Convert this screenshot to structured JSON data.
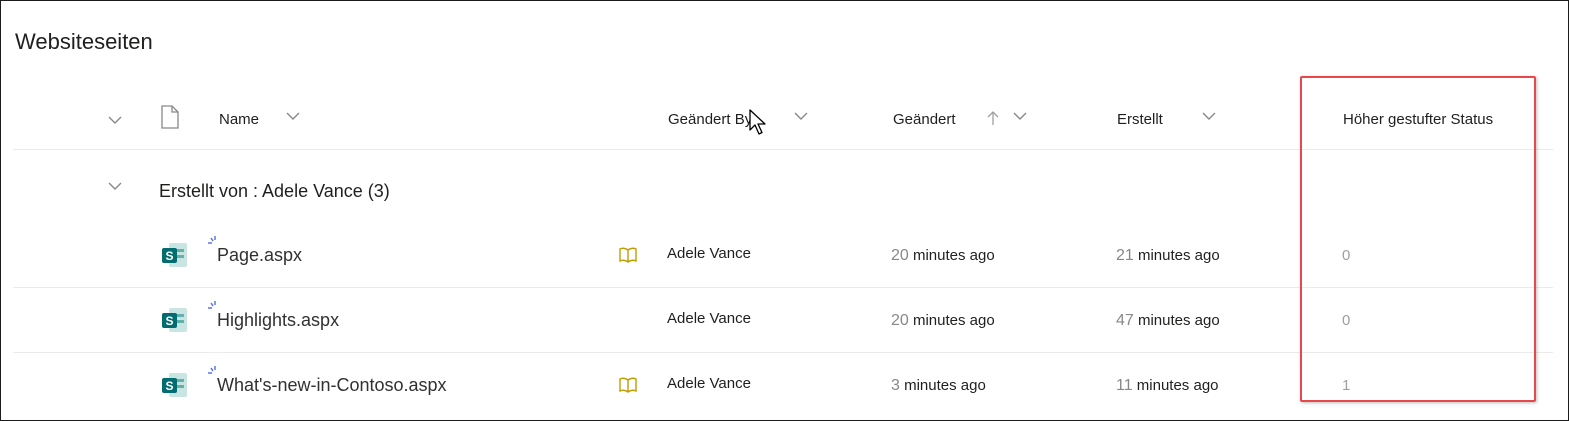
{
  "page": {
    "title": "Websiteseiten"
  },
  "header": {
    "name_label": "Name",
    "modified_by_label": "Geändert By",
    "modified_label": "Geändert",
    "created_label": "Erstellt",
    "promoted_state_label": "Höher gestufter Status"
  },
  "group": {
    "label": "Erstellt von : Adele Vance (3)"
  },
  "rows": [
    {
      "name": "Page.aspx",
      "has_book_icon": true,
      "modified_by": "Adele Vance",
      "modified_num": "20",
      "modified_unit": "minutes ago",
      "created_num": "21",
      "created_unit": "minutes ago",
      "promoted_state": "0"
    },
    {
      "name": "Highlights.aspx",
      "has_book_icon": false,
      "modified_by": "Adele Vance",
      "modified_num": "20",
      "modified_unit": "minutes ago",
      "created_num": "47",
      "created_unit": "minutes ago",
      "promoted_state": "0"
    },
    {
      "name": "What's-new-in-Contoso.aspx",
      "has_book_icon": true,
      "modified_by": "Adele Vance",
      "modified_num": "3",
      "modified_unit": "minutes ago",
      "created_num": "11",
      "created_unit": "minutes ago",
      "promoted_state": "1"
    }
  ],
  "colors": {
    "sharepoint_teal": "#036c70",
    "highlight_red": "#e8474c",
    "new_badge_blue": "#4f6bed",
    "book_icon": "#c19c00"
  },
  "icons": {
    "collapse": "chevron-down-icon",
    "file_type": "document-icon",
    "sort_asc": "arrow-up-icon",
    "cursor": "mouse-pointer-icon",
    "sharepoint_page": "sharepoint-page-icon",
    "new_item": "new-item-badge-icon",
    "book": "book-icon"
  }
}
